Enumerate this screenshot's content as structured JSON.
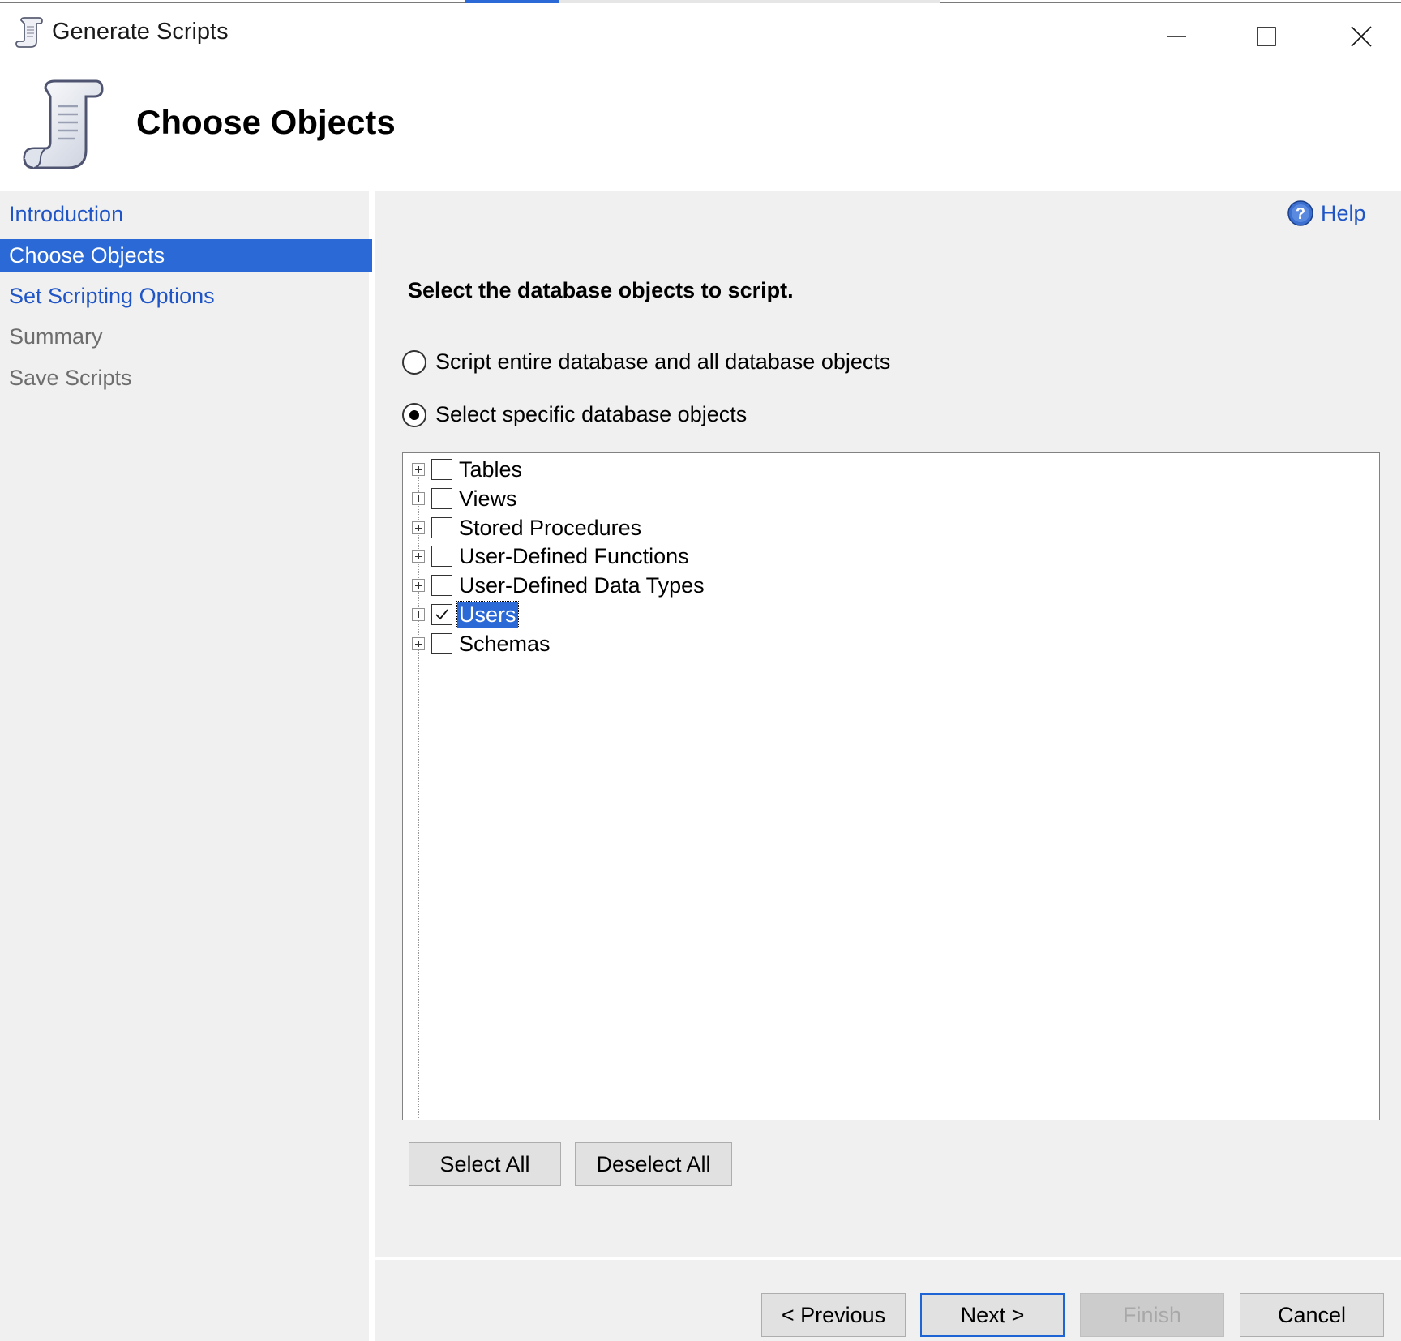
{
  "window": {
    "title": "Generate Scripts",
    "minimize": "—",
    "maximize": "☐",
    "close": "✕"
  },
  "header": {
    "title": "Choose Objects",
    "icon": "script-scroll-icon"
  },
  "sidebar": {
    "items": [
      {
        "label": "Introduction",
        "state": "link"
      },
      {
        "label": "Choose Objects",
        "state": "selected"
      },
      {
        "label": "Set Scripting Options",
        "state": "link"
      },
      {
        "label": "Summary",
        "state": "disabled"
      },
      {
        "label": "Save Scripts",
        "state": "disabled"
      }
    ]
  },
  "main": {
    "help_label": "Help",
    "instruction": "Select the database objects to script.",
    "radio_entire": "Script entire database and all database objects",
    "radio_specific": "Select specific database objects",
    "selected_option": "specific",
    "tree": [
      {
        "label": "Tables",
        "checked": false
      },
      {
        "label": "Views",
        "checked": false
      },
      {
        "label": "Stored Procedures",
        "checked": false
      },
      {
        "label": "User-Defined Functions",
        "checked": false
      },
      {
        "label": "User-Defined Data Types",
        "checked": false
      },
      {
        "label": "Users",
        "checked": true,
        "selected": true
      },
      {
        "label": "Schemas",
        "checked": false
      }
    ],
    "select_all": "Select All",
    "deselect_all": "Deselect All"
  },
  "footer": {
    "previous": "< Previous",
    "next": "Next >",
    "finish": "Finish",
    "cancel": "Cancel"
  },
  "colors": {
    "link": "#1f55c6",
    "selection": "#2b6ad6",
    "panel": "#f0f0f0"
  }
}
